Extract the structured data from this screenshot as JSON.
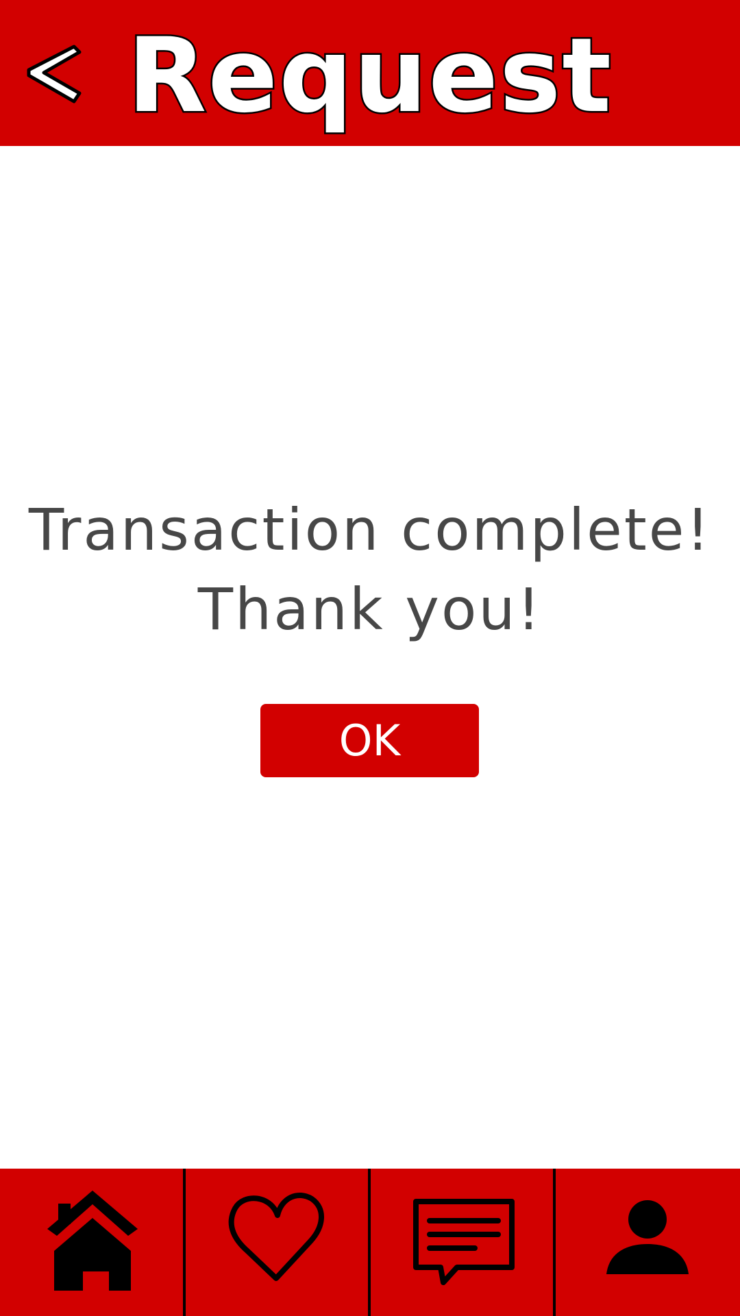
{
  "header": {
    "title": "Request",
    "back_icon": "chevron-left-icon"
  },
  "main": {
    "message_line1": "Transaction complete!",
    "message_line2": "Thank you!",
    "ok_label": "OK"
  },
  "bottom_nav": {
    "items": [
      {
        "icon": "home-icon"
      },
      {
        "icon": "heart-icon"
      },
      {
        "icon": "message-icon"
      },
      {
        "icon": "user-icon"
      }
    ]
  },
  "colors": {
    "brand_red": "#d20000",
    "text_gray": "#474747",
    "white": "#ffffff",
    "black": "#000000"
  }
}
